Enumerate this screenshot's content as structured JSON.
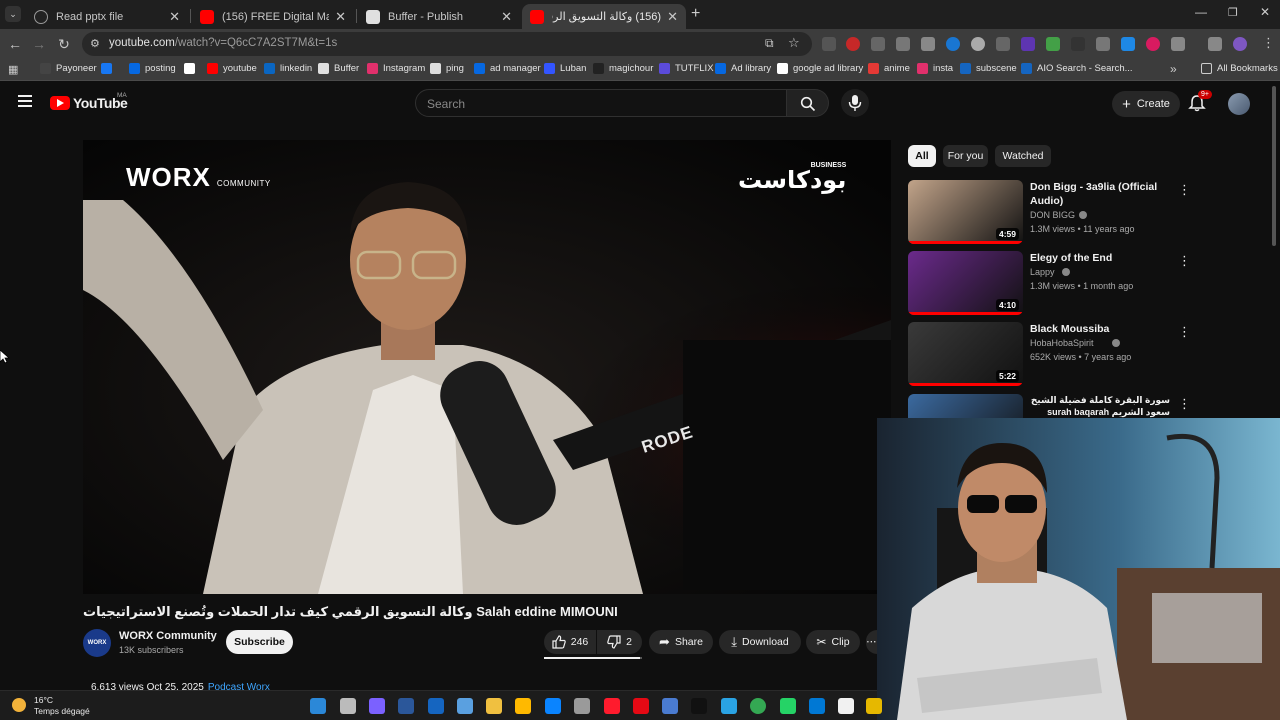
{
  "browser": {
    "tabs": [
      {
        "title": "Read pptx file",
        "active": false
      },
      {
        "title": "(156) FREE Digital Marketing Co",
        "active": false
      },
      {
        "title": "Buffer - Publish",
        "active": false
      },
      {
        "title": "(156) وكالة التسويق الرقمي",
        "active": true
      }
    ],
    "new_tab": "+",
    "url_host": "youtube.com",
    "url_path": "/watch?v=Q6cC7A2ST7M&t=1s",
    "bookmarks": [
      {
        "label": "Payoneer",
        "color": "#444444"
      },
      {
        "label": "",
        "color": "#1877f2"
      },
      {
        "label": "posting",
        "color": "#0668e1"
      },
      {
        "label": "",
        "color": "#ffffff"
      },
      {
        "label": "youtube",
        "color": "#ff0000"
      },
      {
        "label": "linkedin",
        "color": "#0a66c2"
      },
      {
        "label": "Buffer",
        "color": "#e0e0e0"
      },
      {
        "label": "Instagram",
        "color": "#e1306c"
      },
      {
        "label": "ping",
        "color": "#dddddd"
      },
      {
        "label": "ad manager",
        "color": "#0668e1"
      },
      {
        "label": "Luban",
        "color": "#3355ff"
      },
      {
        "label": "magichour",
        "color": "#222222"
      },
      {
        "label": "TUTFLIX",
        "color": "#5b4bdb"
      },
      {
        "label": "Ad library",
        "color": "#0668e1"
      },
      {
        "label": "google ad library",
        "color": "#ffffff"
      },
      {
        "label": "anime",
        "color": "#e53935"
      },
      {
        "label": "insta",
        "color": "#e1306c"
      },
      {
        "label": "subscene",
        "color": "#1565c0"
      },
      {
        "label": "AIO Search - Search...",
        "color": "#1565c0"
      }
    ],
    "more_bookmarks": "»",
    "all_bookmarks": "All Bookmarks"
  },
  "youtube": {
    "logo": "YouTube",
    "region": "MA",
    "search_placeholder": "Search",
    "create_label": "Create",
    "notif_count": "9+",
    "video": {
      "overlay_brand_left": "WORX",
      "overlay_brand_left_sub": "COMMUNITY",
      "overlay_brand_right": "بودكاست",
      "overlay_brand_right_sub": "BUSINESS",
      "mic_brand": "RODE",
      "title": "وكالة التسويق الرقمي كيف تدار الحملات وتُصنع الاستراتيجيات Salah eddine MIMOUNI",
      "channel_avatar": "WORX",
      "channel": "WORX Community",
      "subscribers": "13K subscribers",
      "subscribe": "Subscribe",
      "likes": "246",
      "dislikes": "2",
      "share": "Share",
      "download": "Download",
      "clip": "Clip",
      "views_date": "6,613 views  Oct 25, 2025",
      "tag": "Podcast Worx"
    },
    "chips": [
      "All",
      "For you",
      "Watched"
    ],
    "recommendations": [
      {
        "title": "Don Bigg - 3a9lia (Official Audio)",
        "channel": "DON BIGG",
        "meta": "1.3M views • 11 years ago",
        "duration": "4:59",
        "color": "#c2a48a"
      },
      {
        "title": "Elegy of the End",
        "channel": "Lappy",
        "meta": "1.3M views • 1 month ago",
        "duration": "4:10",
        "color": "#6b2a8c"
      },
      {
        "title": "Black Moussiba",
        "channel": "HobaHobaSpirit",
        "meta": "652K views • 7 years ago",
        "duration": "5:22",
        "color": "#3a3a3a"
      },
      {
        "title": "سورة البقرة كاملة فضيلة الشيخ سعود الشريم surah baqarah saud shuraim",
        "channel": "",
        "meta": "",
        "duration": "",
        "color": "#3b6aa0"
      }
    ]
  },
  "taskbar": {
    "temperature": "16°C",
    "weather": "Temps dégagé"
  }
}
